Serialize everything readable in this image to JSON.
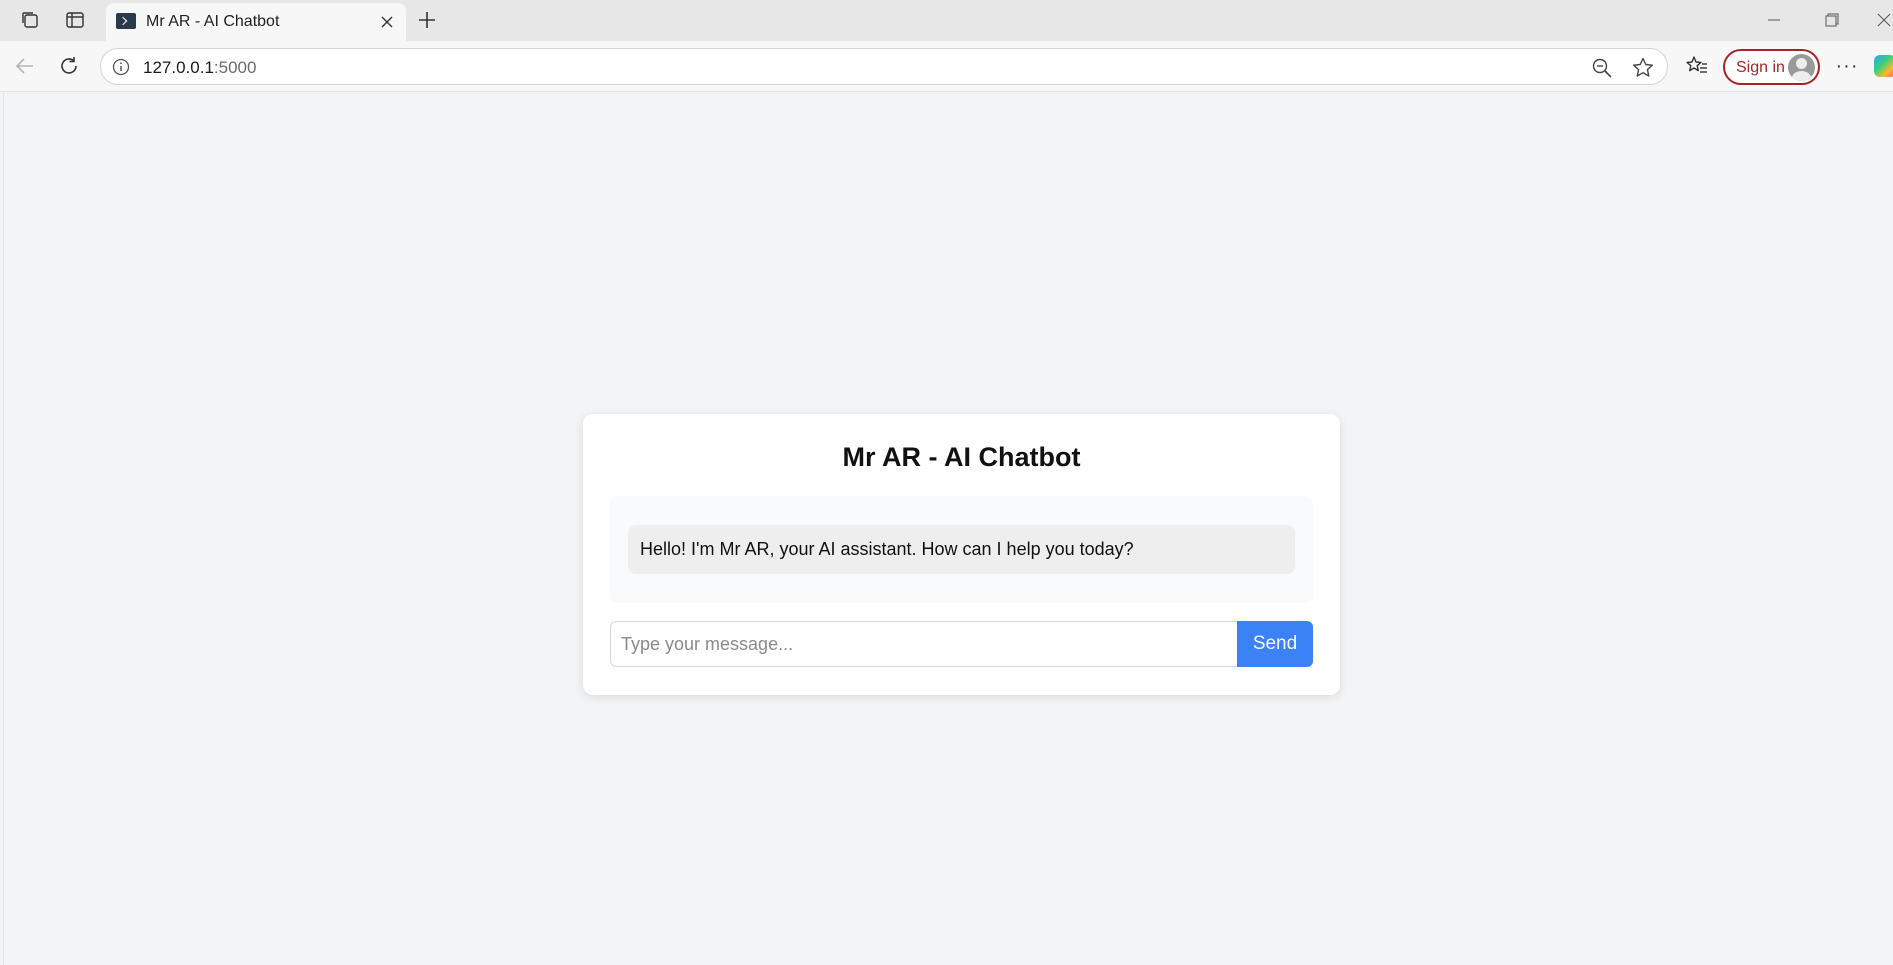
{
  "browser": {
    "tab": {
      "title": "Mr AR - AI Chatbot"
    },
    "address": {
      "host": "127.0.0.1",
      "port": ":5000"
    },
    "signin_label": "Sign in",
    "more_label": "···"
  },
  "chat": {
    "title": "Mr AR - AI Chatbot",
    "messages": [
      {
        "text": "Hello! I'm Mr AR, your AI assistant. How can I help you today?"
      }
    ],
    "input": {
      "placeholder": "Type your message...",
      "value": ""
    },
    "send_label": "Send",
    "colors": {
      "accent": "#3b82f6",
      "page_bg": "#f3f4f6"
    }
  }
}
